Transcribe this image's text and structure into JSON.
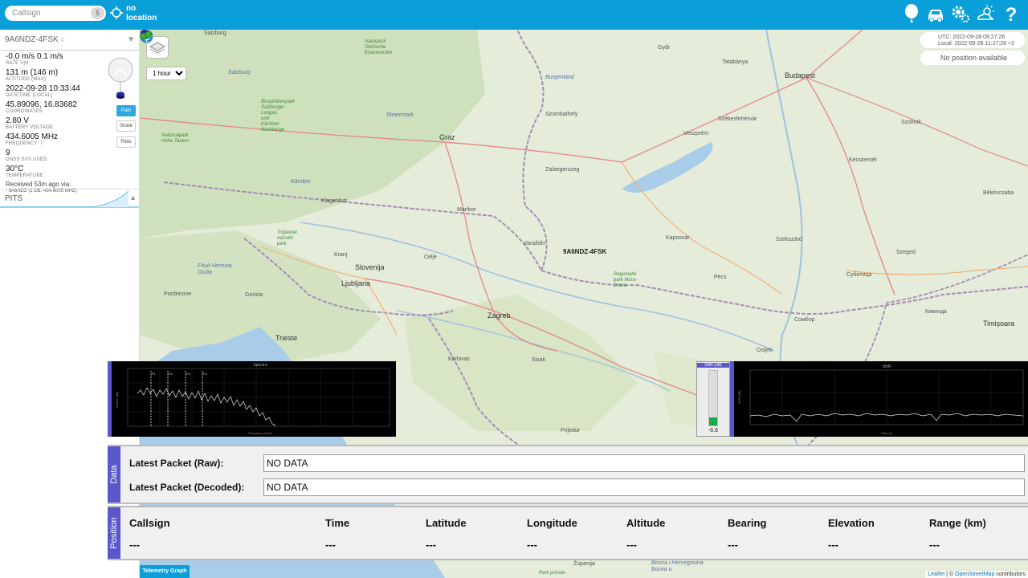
{
  "topbar": {
    "search_placeholder": "Callsign",
    "search_badge": "5",
    "location_text": "no\nlocation",
    "icons": [
      "balloon-icon",
      "car-icon",
      "settings-icon",
      "weather-icon",
      "help-icon"
    ]
  },
  "payload": {
    "callsign": "9A6NDZ-4FSK",
    "fields": [
      {
        "value": "-0.0 m/s 0.1 m/s",
        "label": "RATE V|H"
      },
      {
        "value": "131 m (146 m)",
        "label": "ALTITUDE (MAX)"
      },
      {
        "value": "2022-09-28 10:33:44",
        "label": "DATETIME (LOCAL)"
      },
      {
        "value": "45.89096, 16.83682",
        "label": "COORDINATES"
      },
      {
        "value": "2.80 V",
        "label": "BATTERY VOLTAGE"
      },
      {
        "value": "434.6005 MHz",
        "label": "FREQUENCY ⓘ"
      },
      {
        "value": "9",
        "label": "GNSS SVS USED"
      },
      {
        "value": "30°C",
        "label": "TEMPERATURE"
      }
    ],
    "received": "Received 53m ago via:",
    "received_via": "- 9A6NDZ (2 DB, 434.6005 MHZ)",
    "buttons": {
      "path": "Path",
      "share": "Share",
      "plots": "Plots"
    }
  },
  "pits": {
    "label": "PITS"
  },
  "map": {
    "duration_options": [
      "1 hour"
    ],
    "utc_time": "UTC: 2022-09-28 09:27:26",
    "local_time": "Local: 2022-09-28 11:27:26 +2",
    "position_text": "No position available",
    "marker_label": "9A6NDZ-4FSK",
    "telemetry_button": "Telemetry Graph",
    "attribution_leaflet": "Leaflet",
    "attribution_sep": " | © ",
    "attribution_osm": "OpenStreetMap",
    "attribution_rest": " contributors",
    "labels": {
      "salzburg": "Salzburg",
      "budapest": "Budapest",
      "graz": "Graz",
      "zagreb": "Zagreb",
      "ljubljana": "Ljubljana",
      "slovenija": "Slovenija",
      "trieste": "Trieste",
      "maribor": "Maribor",
      "celje": "Celje",
      "kranj": "Kranj",
      "klagenfurt": "Klagenfurt",
      "varazdin": "Varaždin",
      "karlovac": "Karlovac",
      "sisak": "Sisak",
      "prijedor": "Prijedor",
      "pecs": "Pécs",
      "szeged": "Szeged",
      "osijek": "Osijek",
      "subotica": "Суботица",
      "sombor": "Сомбор",
      "kikinda": "Кикинда",
      "timisoara": "Timișoara",
      "szolnok": "Szolnok",
      "kecskemet": "Kecskemét",
      "bekescsaba": "Békéscsaba",
      "szekszard": "Szekszárd",
      "kaposvar": "Kaposvár",
      "zalaegerszeg": "Zalaegerszeg",
      "szombathely": "Szombathely",
      "veszprem": "Veszprém",
      "szekesfehervar": "Székesfehérvár",
      "tatabanya": "Tatabánya",
      "gyor": "Győr",
      "pordenone": "Pordenone",
      "gorizia": "Gorizia",
      "burgenland": "Burgenland",
      "steiermark": "Steiermark",
      "karnten": "Kärnten",
      "bosna": "Bosna i Hercegovina\nБосна и",
      "friuli": "Friuli-Venezia\nGiulia",
      "salzburg_region": "Salzburg",
      "triglav": "Triglavski\nnarodni\npark",
      "np_hohe": "Nationalpark\nHohe Tauern",
      "biosphere": "Biosphärenpark\nSalzburger\nLungau\nund\nKärntner\nNockberge",
      "mura_drava": "Regionalni\npark Mura-\nDrava",
      "steirische": "Naturpark\nSteirische\nEisenwurzen",
      "zupanija": "Županija",
      "park_prirode": "Park prirode"
    }
  },
  "spectrum": {
    "title": "Spectra",
    "xlabel": "Frequency (kHz)",
    "ylabel": "Power (dB)",
    "marker_labels": [
      "F1",
      "F2",
      "F3",
      "F4"
    ]
  },
  "snr_meter": {
    "title": "SNR (dB)",
    "value": "-6.6"
  },
  "snr_plot": {
    "title": "SNR",
    "xlabel": "Time (s)",
    "ylabel": "SNR (dB)"
  },
  "data": {
    "tab": "Data",
    "raw_label": "Latest Packet (Raw):",
    "raw_value": "NO DATA",
    "decoded_label": "Latest Packet (Decoded):",
    "decoded_value": "NO DATA"
  },
  "position": {
    "tab": "Position",
    "columns": [
      "Callsign",
      "Time",
      "Latitude",
      "Longitude",
      "Altitude",
      "Bearing",
      "Elevation",
      "Range (km)"
    ],
    "values": [
      "---",
      "---",
      "---",
      "---",
      "---",
      "---",
      "---",
      "---"
    ]
  },
  "colors": {
    "topbar": "#0a9fd8",
    "tab_purple": "#5a57c9",
    "snr_green": "#1aa84b"
  }
}
